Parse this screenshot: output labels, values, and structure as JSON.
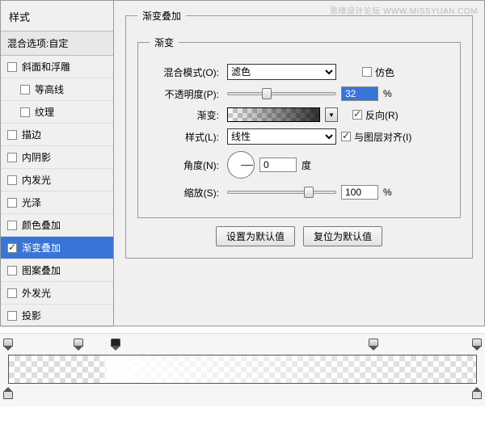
{
  "watermark": "思缘设计论坛  WWW.MISSYUAN.COM",
  "sidebar": {
    "title": "样式",
    "blend_option": "混合选项:自定",
    "items": [
      {
        "label": "斜面和浮雕",
        "checked": false,
        "indent": false
      },
      {
        "label": "等高线",
        "checked": false,
        "indent": true
      },
      {
        "label": "纹理",
        "checked": false,
        "indent": true
      },
      {
        "label": "描边",
        "checked": false,
        "indent": false
      },
      {
        "label": "内阴影",
        "checked": false,
        "indent": false
      },
      {
        "label": "内发光",
        "checked": false,
        "indent": false
      },
      {
        "label": "光泽",
        "checked": false,
        "indent": false
      },
      {
        "label": "颜色叠加",
        "checked": false,
        "indent": false
      },
      {
        "label": "渐变叠加",
        "checked": true,
        "indent": false,
        "selected": true
      },
      {
        "label": "图案叠加",
        "checked": false,
        "indent": false
      },
      {
        "label": "外发光",
        "checked": false,
        "indent": false
      },
      {
        "label": "投影",
        "checked": false,
        "indent": false
      }
    ]
  },
  "panel": {
    "group_title": "渐变叠加",
    "inner_title": "渐变",
    "blend_mode_label": "混合模式(O):",
    "blend_mode_value": "滤色",
    "dither_label": "仿色",
    "dither_checked": false,
    "opacity_label": "不透明度(P):",
    "opacity_value": "32",
    "opacity_unit": "%",
    "gradient_label": "渐变:",
    "reverse_label": "反向(R)",
    "reverse_checked": true,
    "style_label": "样式(L):",
    "style_value": "线性",
    "align_label": "与图层对齐(I)",
    "align_checked": true,
    "angle_label": "角度(N):",
    "angle_value": "0",
    "angle_unit": "度",
    "scale_label": "缩放(S):",
    "scale_value": "100",
    "scale_unit": "%",
    "btn_default": "设置为默认值",
    "btn_reset": "复位为默认值"
  },
  "gradient_editor": {
    "opacity_stops": [
      0,
      15,
      23,
      78,
      100
    ],
    "filled_stop": 23,
    "color_stops": [
      0,
      100
    ]
  }
}
